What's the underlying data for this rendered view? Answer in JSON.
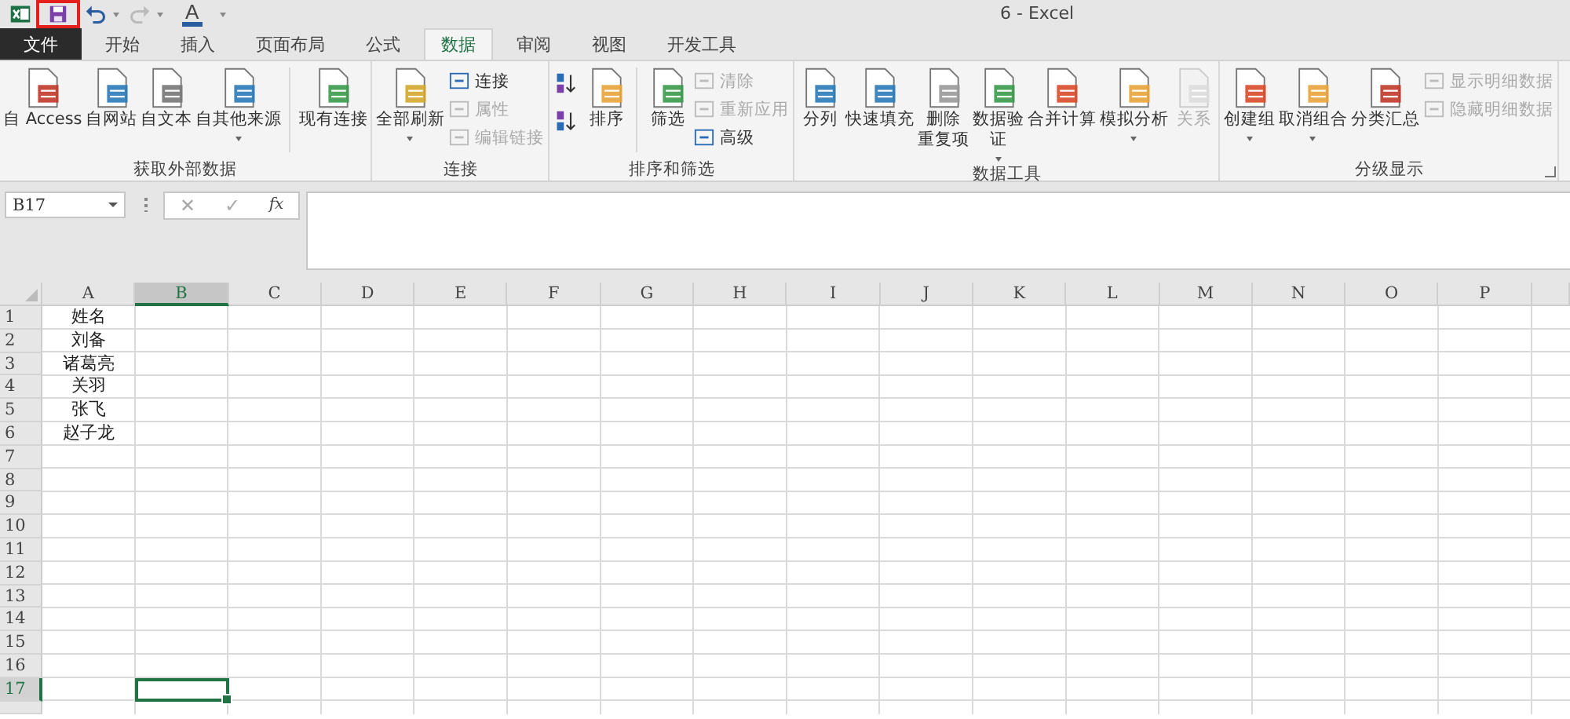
{
  "window": {
    "title": "6 - Excel"
  },
  "quick_access": {
    "font_color_glyph": "A",
    "redo_disabled": true,
    "save_highlighted": true
  },
  "tabs": [
    {
      "label": "文件",
      "kind": "file",
      "selected": false
    },
    {
      "label": "开始",
      "kind": "normal",
      "selected": false
    },
    {
      "label": "插入",
      "kind": "normal",
      "selected": false
    },
    {
      "label": "页面布局",
      "kind": "normal",
      "selected": false
    },
    {
      "label": "公式",
      "kind": "normal",
      "selected": false
    },
    {
      "label": "数据",
      "kind": "normal",
      "selected": true
    },
    {
      "label": "审阅",
      "kind": "normal",
      "selected": false
    },
    {
      "label": "视图",
      "kind": "normal",
      "selected": false
    },
    {
      "label": "开发工具",
      "kind": "normal",
      "selected": false
    }
  ],
  "ribbon": {
    "groups": [
      {
        "label": "获取外部数据",
        "launcher": false,
        "items": [
          {
            "kind": "large",
            "label": "自 Access",
            "disabled": false,
            "dropdown": false
          },
          {
            "kind": "large",
            "label": "自网站",
            "disabled": false,
            "dropdown": false
          },
          {
            "kind": "large",
            "label": "自文本",
            "disabled": false,
            "dropdown": false
          },
          {
            "kind": "large",
            "label": "自其他来源",
            "disabled": false,
            "dropdown": true
          },
          {
            "kind": "separator"
          },
          {
            "kind": "large",
            "label": "现有连接",
            "disabled": false,
            "dropdown": false
          }
        ]
      },
      {
        "label": "连接",
        "launcher": false,
        "items": [
          {
            "kind": "large",
            "label": "全部刷新",
            "disabled": false,
            "dropdown": true
          },
          {
            "kind": "stack",
            "buttons": [
              {
                "label": "连接",
                "disabled": false
              },
              {
                "label": "属性",
                "disabled": true
              },
              {
                "label": "编辑链接",
                "disabled": true
              }
            ]
          }
        ]
      },
      {
        "label": "排序和筛选",
        "launcher": false,
        "items": [
          {
            "kind": "sortpair"
          },
          {
            "kind": "large",
            "label": "排序",
            "disabled": false,
            "dropdown": false
          },
          {
            "kind": "separator"
          },
          {
            "kind": "large",
            "label": "筛选",
            "disabled": false,
            "dropdown": false
          },
          {
            "kind": "stack",
            "buttons": [
              {
                "label": "清除",
                "disabled": true
              },
              {
                "label": "重新应用",
                "disabled": true
              },
              {
                "label": "高级",
                "disabled": false
              }
            ]
          }
        ]
      },
      {
        "label": "数据工具",
        "launcher": false,
        "items": [
          {
            "kind": "large",
            "label": "分列",
            "disabled": false,
            "dropdown": false
          },
          {
            "kind": "large",
            "label": "快速填充",
            "disabled": false,
            "dropdown": false
          },
          {
            "kind": "large",
            "label": "删除",
            "label2": "重复项",
            "disabled": false,
            "dropdown": false
          },
          {
            "kind": "large",
            "label": "数据验",
            "label2": "证",
            "disabled": false,
            "dropdown": true
          },
          {
            "kind": "large",
            "label": "合并计算",
            "disabled": false,
            "dropdown": false
          },
          {
            "kind": "large",
            "label": "模拟分析",
            "disabled": false,
            "dropdown": true
          },
          {
            "kind": "large",
            "label": "关系",
            "disabled": true,
            "dropdown": false
          }
        ]
      },
      {
        "label": "分级显示",
        "launcher": true,
        "items": [
          {
            "kind": "large",
            "label": "创建组",
            "disabled": false,
            "dropdown": true
          },
          {
            "kind": "large",
            "label": "取消组合",
            "disabled": false,
            "dropdown": true
          },
          {
            "kind": "large",
            "label": "分类汇总",
            "disabled": false,
            "dropdown": false
          },
          {
            "kind": "stack",
            "buttons": [
              {
                "label": "显示明细数据",
                "disabled": true
              },
              {
                "label": "隐藏明细数据",
                "disabled": true
              }
            ]
          }
        ]
      }
    ]
  },
  "formula_bar": {
    "name_box": "B17",
    "cancel": "✕",
    "enter": "✓",
    "function": "fx",
    "value_disabled": true
  },
  "sheet": {
    "columns": [
      {
        "label": "A",
        "selected": false
      },
      {
        "label": "B",
        "selected": true
      },
      {
        "label": "C",
        "selected": false
      },
      {
        "label": "D",
        "selected": false
      },
      {
        "label": "E",
        "selected": false
      },
      {
        "label": "F",
        "selected": false
      },
      {
        "label": "G",
        "selected": false
      },
      {
        "label": "H",
        "selected": false
      },
      {
        "label": "I",
        "selected": false
      },
      {
        "label": "J",
        "selected": false
      },
      {
        "label": "K",
        "selected": false
      },
      {
        "label": "L",
        "selected": false
      },
      {
        "label": "M",
        "selected": false
      },
      {
        "label": "N",
        "selected": false
      },
      {
        "label": "O",
        "selected": false
      },
      {
        "label": "P",
        "selected": false
      }
    ],
    "rows": [
      {
        "label": "1",
        "selected": false,
        "cells": [
          "姓名"
        ]
      },
      {
        "label": "2",
        "selected": false,
        "cells": [
          "刘备"
        ]
      },
      {
        "label": "3",
        "selected": false,
        "cells": [
          "诸葛亮"
        ]
      },
      {
        "label": "4",
        "selected": false,
        "cells": [
          "关羽"
        ]
      },
      {
        "label": "5",
        "selected": false,
        "cells": [
          "张飞"
        ]
      },
      {
        "label": "6",
        "selected": false,
        "cells": [
          "赵子龙"
        ]
      },
      {
        "label": "7",
        "selected": false,
        "cells": []
      },
      {
        "label": "8",
        "selected": false,
        "cells": []
      },
      {
        "label": "9",
        "selected": false,
        "cells": []
      },
      {
        "label": "10",
        "selected": false,
        "cells": []
      },
      {
        "label": "11",
        "selected": false,
        "cells": []
      },
      {
        "label": "12",
        "selected": false,
        "cells": []
      },
      {
        "label": "13",
        "selected": false,
        "cells": []
      },
      {
        "label": "14",
        "selected": false,
        "cells": []
      },
      {
        "label": "15",
        "selected": false,
        "cells": []
      },
      {
        "label": "16",
        "selected": false,
        "cells": []
      },
      {
        "label": "17",
        "selected": true,
        "cells": []
      }
    ]
  }
}
